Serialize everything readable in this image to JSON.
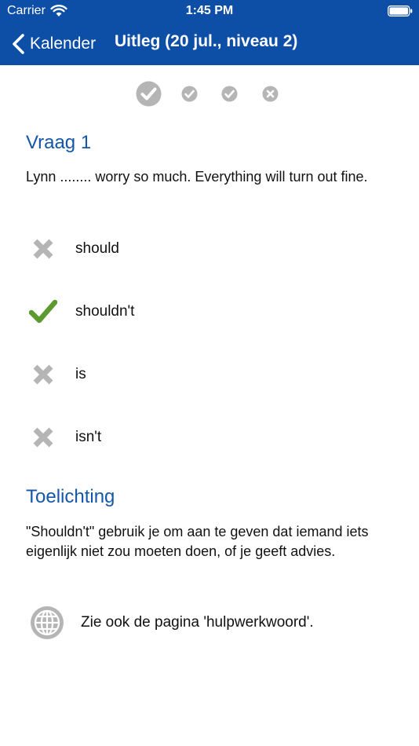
{
  "status_bar": {
    "carrier": "Carrier",
    "time": "1:45 PM"
  },
  "nav": {
    "back_label": "Kalender",
    "title": "Uitleg (20 jul., niveau 2)"
  },
  "progress": [
    {
      "state": "correct",
      "current": true,
      "icon": "check-circle-icon"
    },
    {
      "state": "correct",
      "current": false,
      "icon": "check-circle-icon"
    },
    {
      "state": "correct",
      "current": false,
      "icon": "check-circle-icon"
    },
    {
      "state": "wrong",
      "current": false,
      "icon": "x-circle-icon"
    }
  ],
  "question": {
    "heading": "Vraag 1",
    "text": "Lynn ........ worry so much. Everything will turn out fine.",
    "answers": [
      {
        "label": "should",
        "result": "wrong",
        "icon": "cross-icon"
      },
      {
        "label": "shouldn't",
        "result": "correct",
        "icon": "checkmark-icon"
      },
      {
        "label": "is",
        "result": "wrong",
        "icon": "cross-icon"
      },
      {
        "label": "isn't",
        "result": "wrong",
        "icon": "cross-icon"
      }
    ]
  },
  "explanation": {
    "heading": "Toelichting",
    "text": "\"Shouldn't\" gebruik je om aan te geven dat iemand iets eigenlijk niet zou moeten doen, of je geeft advies.",
    "link_label": "Zie ook de pagina 'hulpwerkwoord'.",
    "link_icon": "globe-icon"
  },
  "colors": {
    "nav_background": "#0d4ea6",
    "heading_blue": "#1456a8",
    "correct_green": "#5a9a2e",
    "icon_gray": "#b5b5b5"
  }
}
